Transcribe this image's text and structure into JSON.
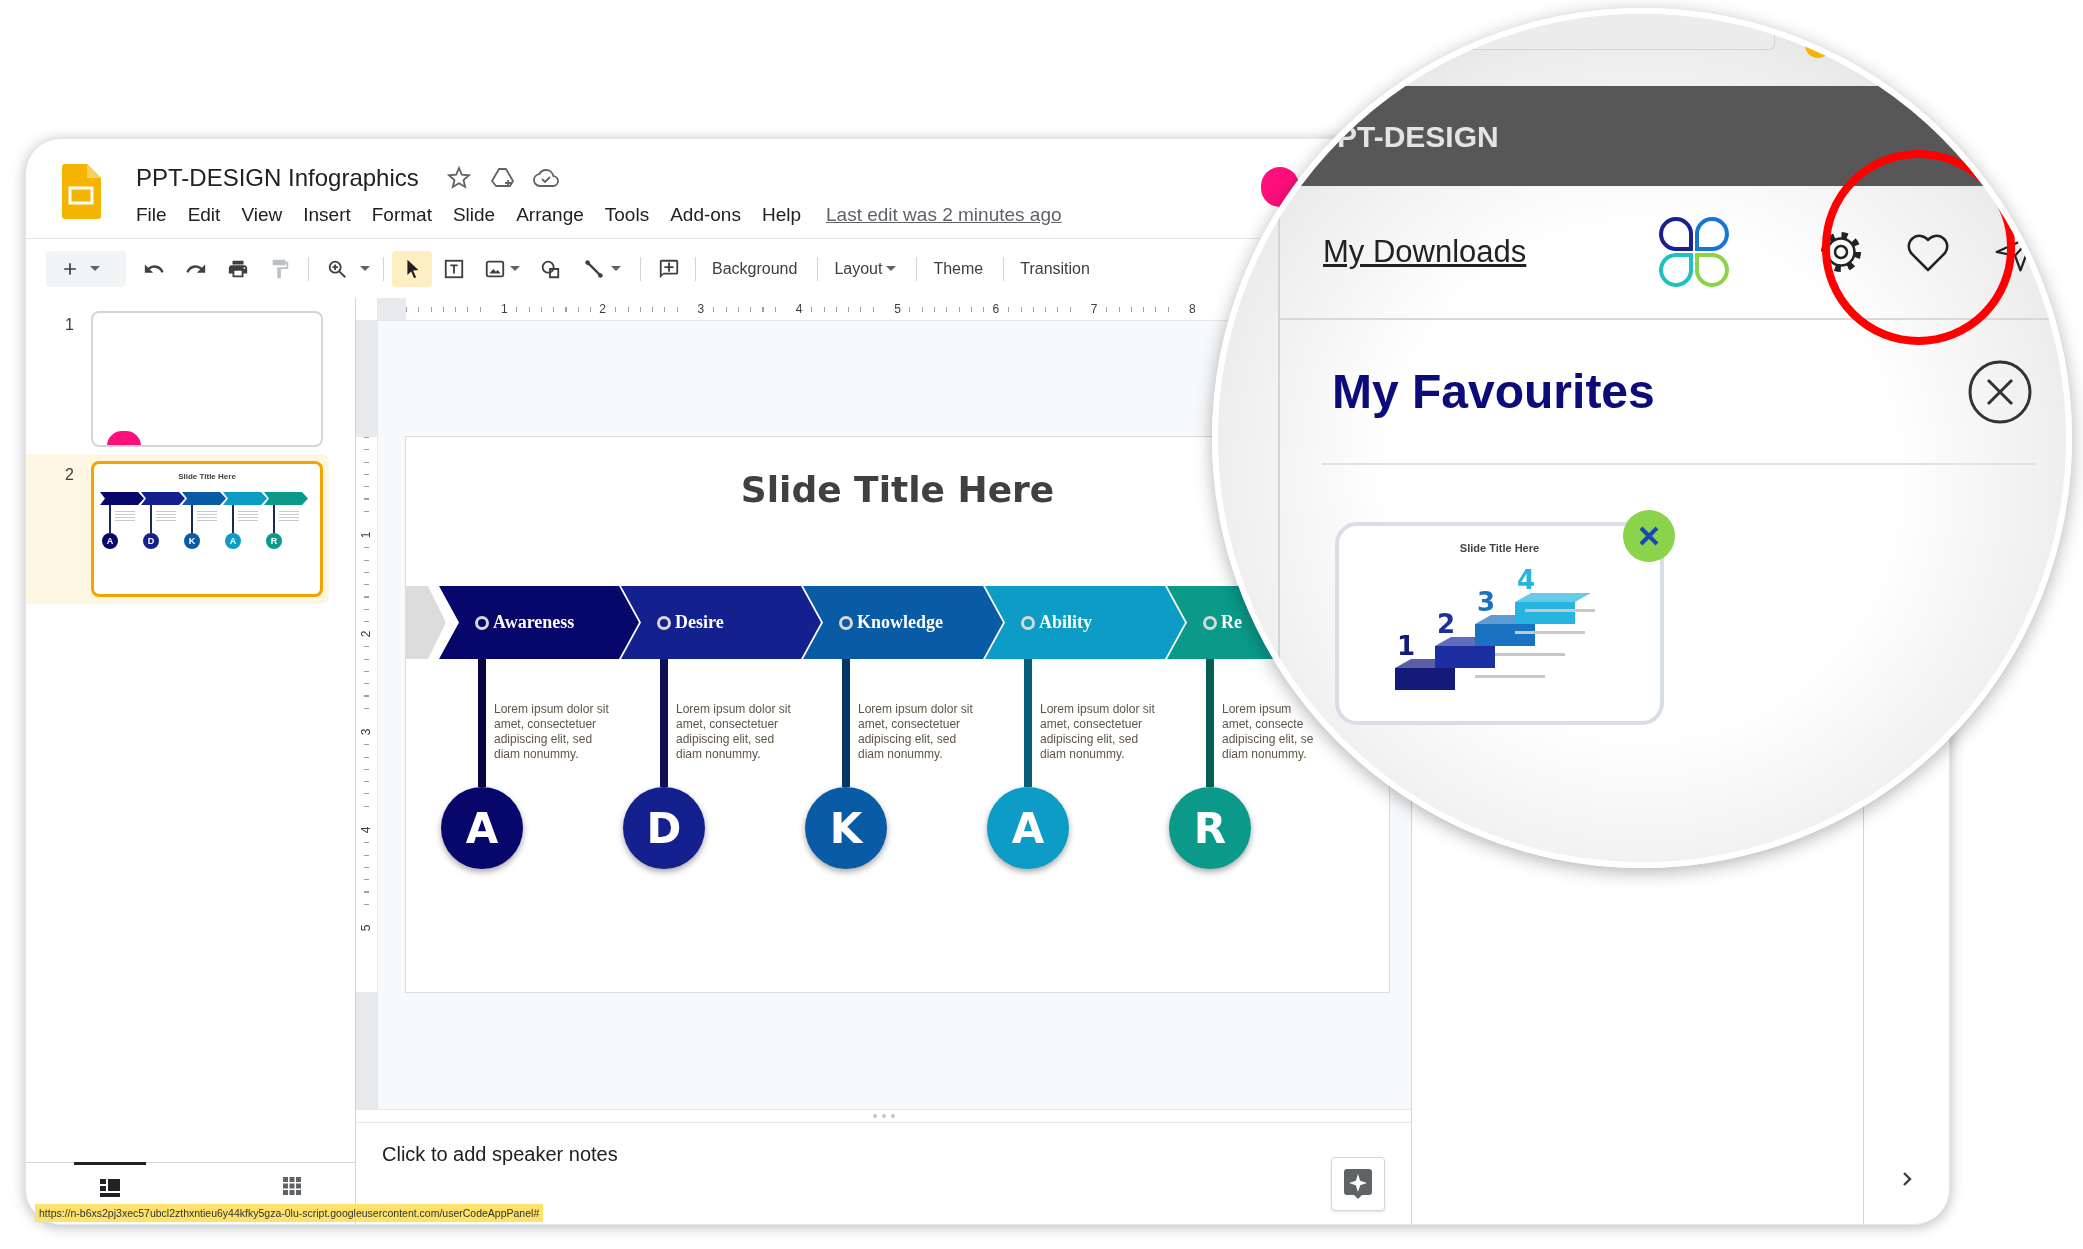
{
  "app": {
    "title": "PPT-DESIGN Infographics",
    "menu": [
      "File",
      "Edit",
      "View",
      "Insert",
      "Format",
      "Slide",
      "Arrange",
      "Tools",
      "Add-ons",
      "Help"
    ],
    "last_edit": "Last edit was 2 minutes ago"
  },
  "toolbar": {
    "select_tool": {
      "selected": true
    },
    "paint_format": {
      "disabled": true
    },
    "text_buttons": [
      {
        "label": "Background",
        "dropdown": false
      },
      {
        "label": "Layout",
        "dropdown": true
      },
      {
        "label": "Theme",
        "dropdown": false
      },
      {
        "label": "Transition",
        "dropdown": false
      }
    ]
  },
  "ruler": {
    "horizontal": [
      "1",
      "2",
      "3",
      "4",
      "5",
      "6",
      "7",
      "8"
    ],
    "vertical": [
      "1",
      "2",
      "3",
      "4",
      "5"
    ]
  },
  "filmstrip": {
    "slides": [
      {
        "number": "1",
        "selected": false,
        "kind": "blank"
      },
      {
        "number": "2",
        "selected": true,
        "kind": "infographic",
        "title": "Slide Title Here",
        "letters": [
          "A",
          "D",
          "K",
          "A",
          "R"
        ]
      }
    ]
  },
  "slide": {
    "title": "Slide Title Here",
    "steps": [
      {
        "label": "Awareness",
        "letter": "A",
        "color": "#07076b",
        "lines": [
          "Lorem ipsum dolor sit",
          "amet, consectetuer",
          "adipiscing elit, sed",
          "diam nonummy."
        ]
      },
      {
        "label": "Desire",
        "letter": "D",
        "color": "#15208f",
        "lines": [
          "Lorem ipsum dolor sit",
          "amet, consectetuer",
          "adipiscing elit, sed",
          "diam nonummy."
        ]
      },
      {
        "label": "Knowledge",
        "letter": "K",
        "color": "#0a5ba6",
        "lines": [
          "Lorem ipsum dolor sit",
          "amet, consectetuer",
          "adipiscing elit, sed",
          "diam nonummy."
        ]
      },
      {
        "label": "Ability",
        "letter": "A",
        "color": "#0c9cc6",
        "lines": [
          "Lorem ipsum dolor sit",
          "amet, consectetuer",
          "adipiscing elit, sed",
          "diam nonummy."
        ]
      },
      {
        "label": "Re",
        "letter": "R",
        "color": "#0b9a8a",
        "lines": [
          "Lorem ipsum",
          "amet, consecte",
          "adipiscing elit, se",
          "diam nonummy."
        ]
      }
    ]
  },
  "speaker_notes": {
    "prompt": "Click to add speaker notes"
  },
  "status_url": "https://n-b6xs2pj3xec57ubcl2zthxntieu6y44kfky5gza-0lu-script.googleusercontent.com/userCodeAppPanel#",
  "magnifier": {
    "brand": "PT-DESIGN",
    "nav_link": "My Downloads",
    "heading": "My Favourites",
    "favourites": [
      {
        "title": "Slide Title Here",
        "steps": [
          "1",
          "2",
          "3",
          "4"
        ]
      }
    ]
  }
}
